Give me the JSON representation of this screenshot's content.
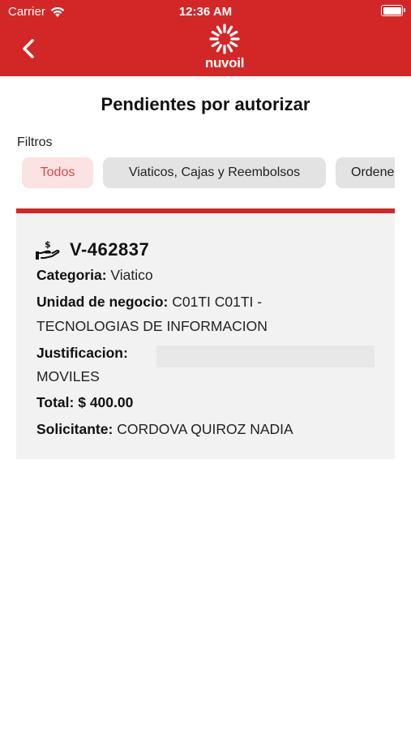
{
  "status_bar": {
    "carrier": "Carrier",
    "time": "12:36 AM"
  },
  "header": {
    "brand": "nuvoil",
    "accent_color": "#d32727"
  },
  "page_title": "Pendientes por autorizar",
  "filters": {
    "label": "Filtros",
    "chips": [
      "Todos",
      "Viaticos, Cajas y Reembolsos",
      "Ordenes"
    ],
    "active": "Todos"
  },
  "card": {
    "code": "V-462837",
    "categoria_label": "Categoria:",
    "categoria": "Viatico",
    "unidad_label": "Unidad de negocio:",
    "unidad_line1": "C01TI C01TI -",
    "unidad_line2": "TECNOLOGIAS DE INFORMACION",
    "justificacion_label": "Justificacion:",
    "justificacion_line2": "MOVILES",
    "total_label": "Total:",
    "total": "$ 400.00",
    "solicitante_label": "Solicitante:",
    "solicitante": "CORDOVA QUIROZ NADIA"
  }
}
